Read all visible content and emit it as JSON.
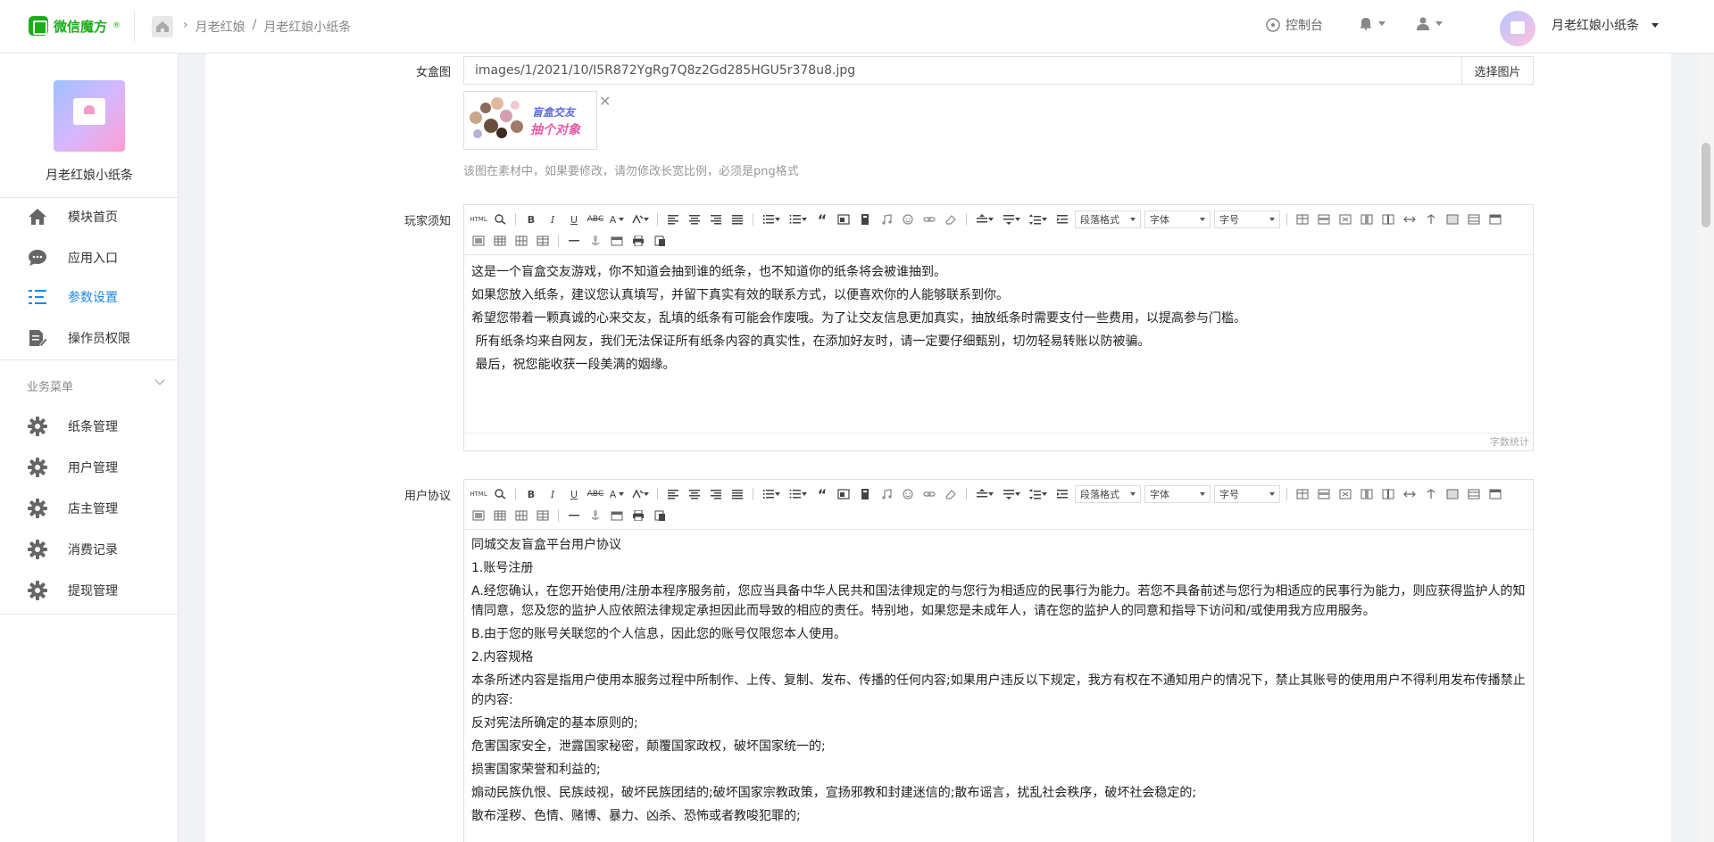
{
  "topbar": {
    "logo_text": "微信魔方",
    "logo_sup": "®",
    "breadcrumb": [
      "月老红娘",
      "/",
      "月老红娘小纸条"
    ],
    "console": "控制台",
    "account_name": "月老红娘小纸条"
  },
  "sidebar": {
    "app_name": "月老红娘小纸条",
    "items": [
      {
        "label": "模块首页",
        "icon": "home-icon"
      },
      {
        "label": "应用入口",
        "icon": "chat-icon"
      },
      {
        "label": "参数设置",
        "icon": "list-settings-icon"
      },
      {
        "label": "操作员权限",
        "icon": "doc-edit-icon"
      }
    ],
    "group_label": "业务菜单",
    "biz_items": [
      {
        "label": "纸条管理",
        "icon": "gear-icon"
      },
      {
        "label": "用户管理",
        "icon": "gear-icon"
      },
      {
        "label": "店主管理",
        "icon": "gear-icon"
      },
      {
        "label": "消费记录",
        "icon": "gear-icon"
      },
      {
        "label": "提现管理",
        "icon": "gear-icon"
      }
    ],
    "active_item": "参数设置",
    "active_color": "#1e88e5"
  },
  "form": {
    "blindbox_label": "女盒图",
    "blindbox_value": "images/1/2021/10/I5R872YgRg7Q8z2Gd285HGU5r378u8.jpg",
    "select_image": "选择图片",
    "thumb_line1": "盲盒交友",
    "thumb_line2": "抽个对象",
    "help_text": "该图在素材中，如果要修改，请勿修改长宽比例，必须是png格式",
    "rules_label": "玩家须知",
    "rules_lines": [
      "这是一个盲盒交友游戏，你不知道会抽到谁的纸条，也不知道你的纸条将会被谁抽到。",
      "如果您放入纸条，建议您认真填写，并留下真实有效的联系方式，以便喜欢你的人能够联系到你。",
      "希望您带着一颗真诚的心来交友，乱填的纸条有可能会作废哦。为了让交友信息更加真实，抽放纸条时需要支付一些费用，以提高参与门槛。",
      " 所有纸条均来自网友，我们无法保证所有纸条内容的真实性，在添加好友时，请一定要仔细甄别，切勿轻易转账以防被骗。",
      " 最后，祝您能收获一段美满的姻缘。"
    ],
    "word_count": "字数统计",
    "agreement_label": "用户协议",
    "agreement_lines": [
      "同城交友盲盒平台用户协议",
      "1.账号注册",
      "A.经您确认，在您开始使用/注册本程序服务前，您应当具备中华人民共和国法律规定的与您行为相适应的民事行为能力。若您不具备前述与您行为相适应的民事行为能力，则应获得监护人的知情同意，您及您的监护人应依照法律规定承担因此而导致的相应的责任。特别地，如果您是未成年人，请在您的监护人的同意和指导下访问和/或使用我方应用服务。",
      "B.由于您的账号关联您的个人信息，因此您的账号仅限您本人使用。",
      "2.内容规格",
      "本条所述内容是指用户使用本服务过程中所制作、上传、复制、发布、传播的任何内容;如果用户违反以下规定，我方有权在不通知用户的情况下，禁止其账号的使用用户不得利用发布传播禁止的内容:",
      "反对宪法所确定的基本原则的;",
      "危害国家安全，泄露国家秘密，颠覆国家政权，破坏国家统一的;",
      "损害国家荣誉和利益的;",
      "煽动民族仇恨、民族歧视，破坏民族团结的;破坏国家宗教政策，宣扬邪教和封建迷信的;散布谣言，扰乱社会秩序，破坏社会稳定的;",
      "散布淫秽、色情、赌博、暴力、凶杀、恐怖或者教唆犯罪的;"
    ]
  },
  "toolbar": {
    "html": "HTML",
    "bold": "B",
    "italic": "I",
    "underline": "U",
    "strike": "ABC",
    "fontcolor": "A",
    "paragraph": "段落格式",
    "fontfamily": "字体",
    "fontsize": "字号"
  }
}
